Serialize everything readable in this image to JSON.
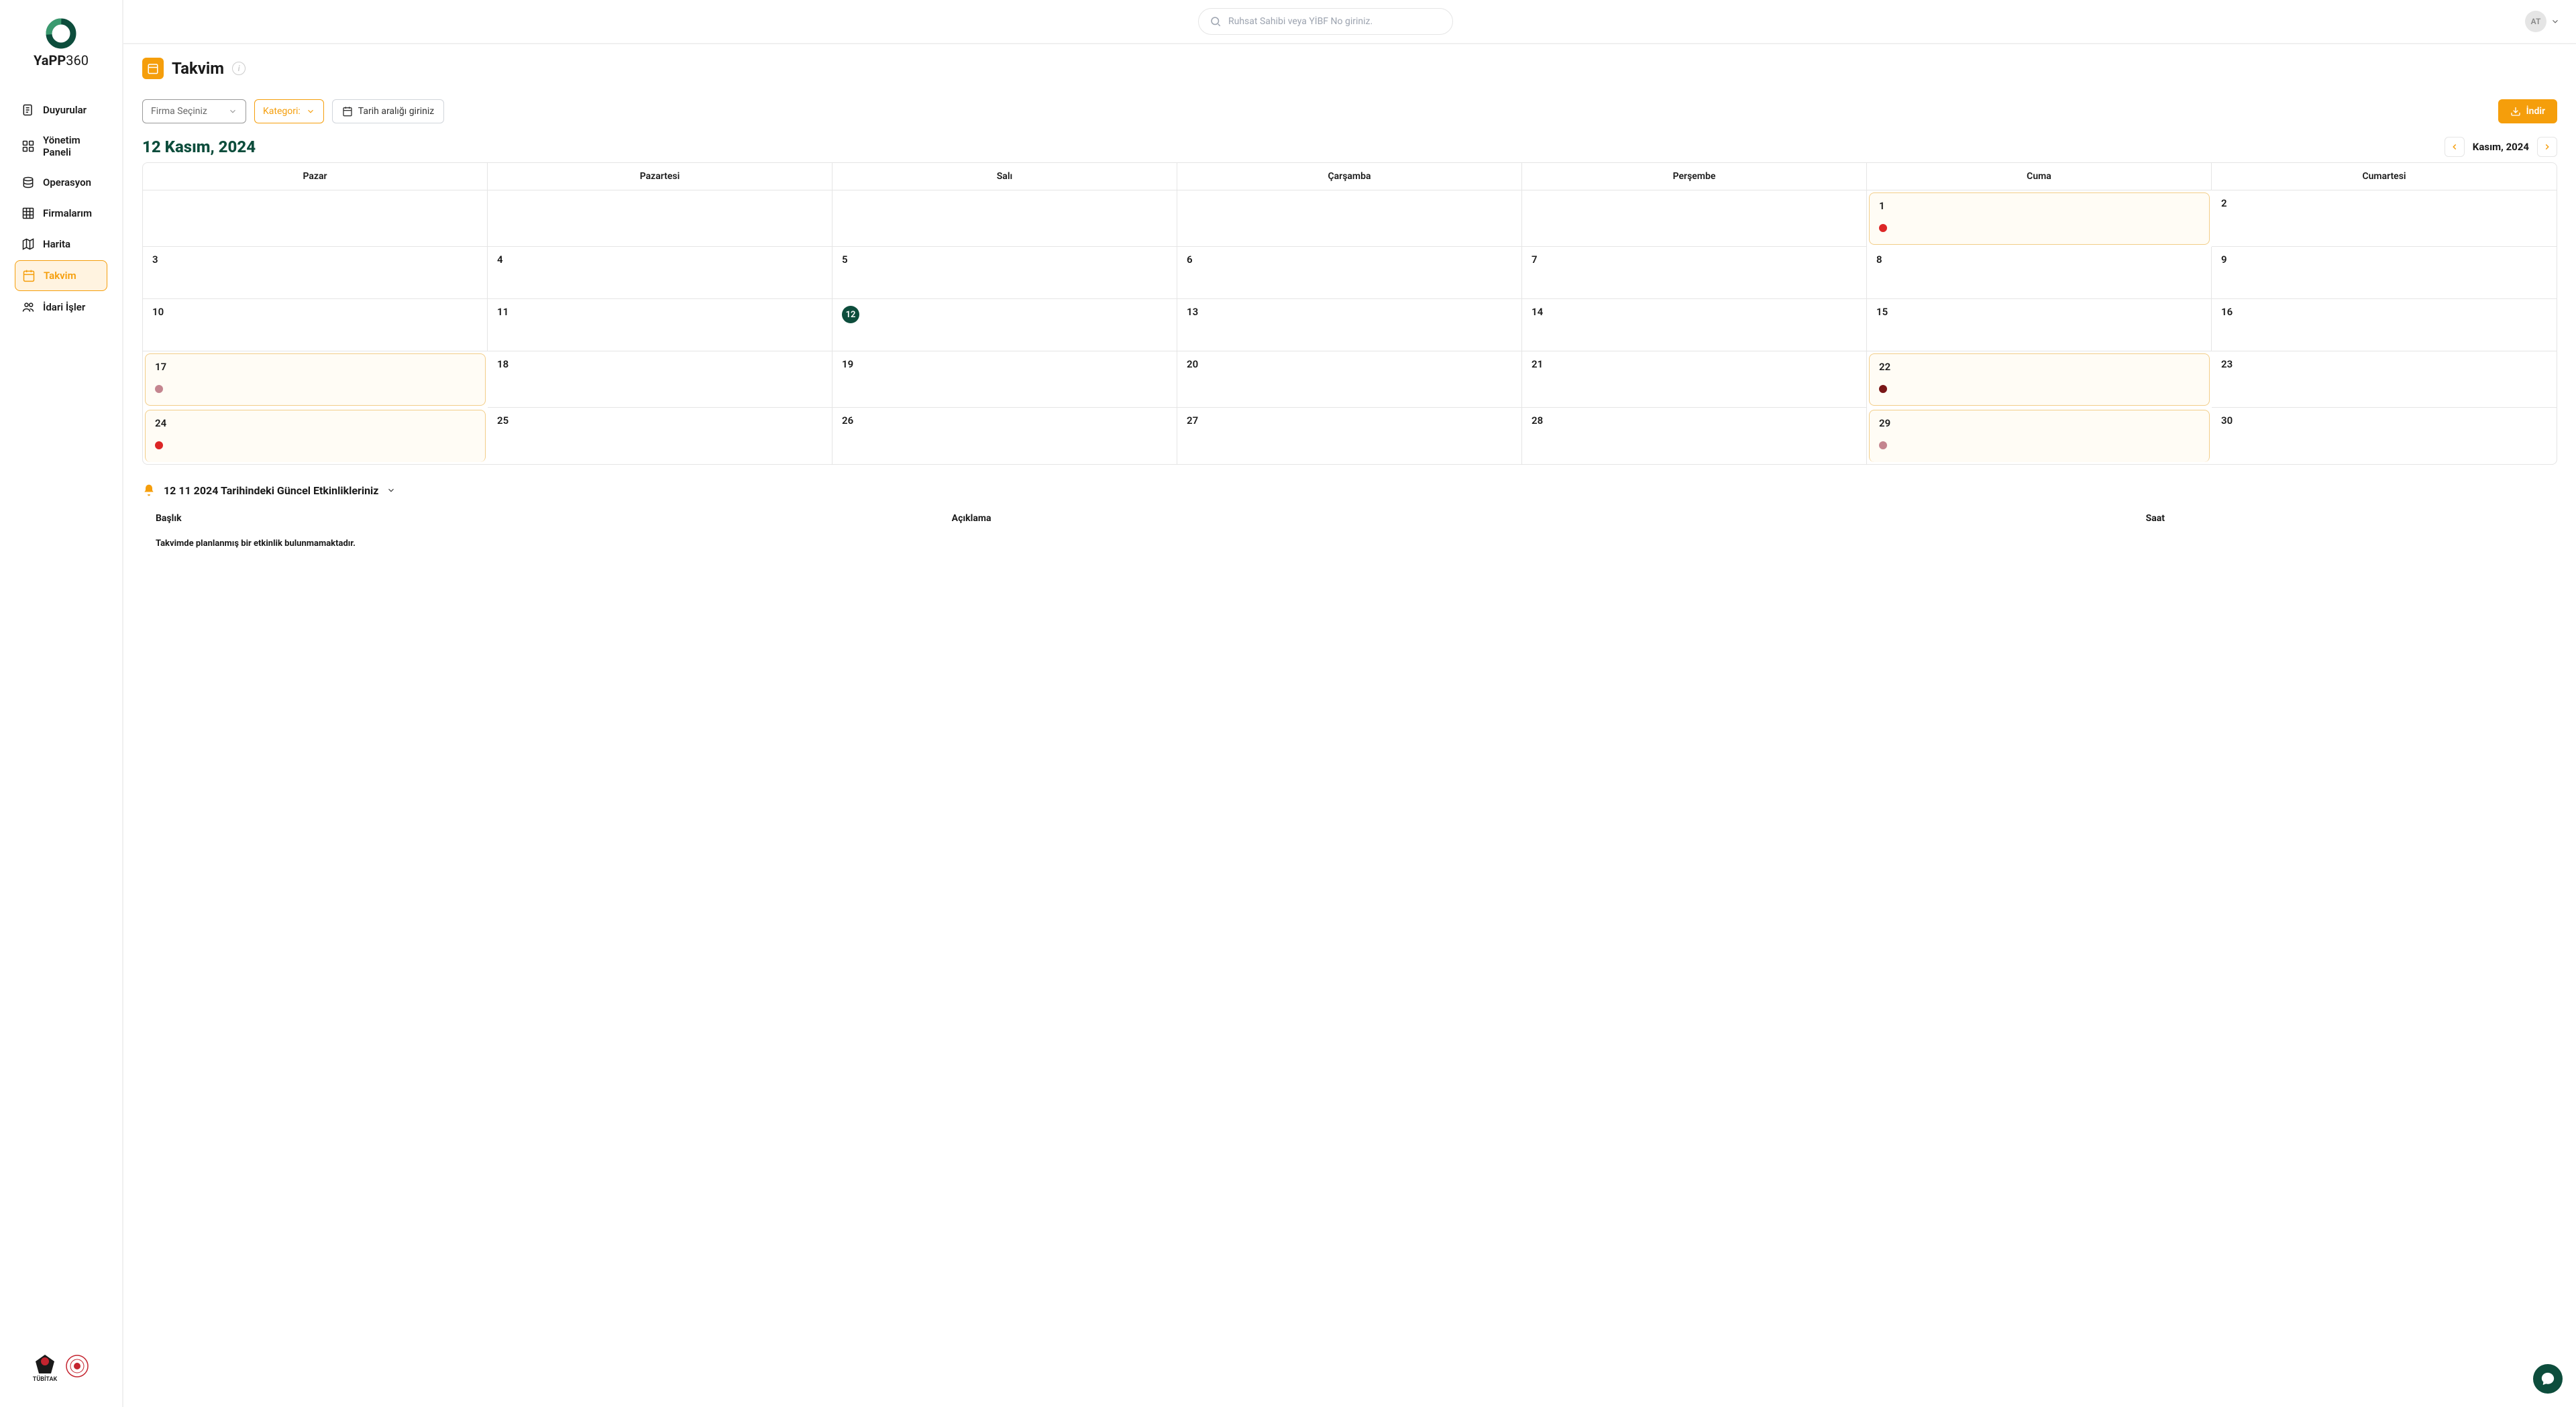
{
  "brand": {
    "name_bold": "YaPP",
    "name_thin": "360"
  },
  "search": {
    "placeholder": "Ruhsat Sahibi veya YİBF No giriniz."
  },
  "user": {
    "initials": "AT"
  },
  "nav": [
    {
      "label": "Duyurular"
    },
    {
      "label": "Yönetim Paneli"
    },
    {
      "label": "Operasyon"
    },
    {
      "label": "Firmalarım"
    },
    {
      "label": "Harita"
    },
    {
      "label": "Takvim"
    },
    {
      "label": "İdari İşler"
    }
  ],
  "page": {
    "title": "Takvim"
  },
  "filters": {
    "firma": "Firma Seçiniz",
    "kategori": "Kategori:",
    "date_range": "Tarih aralığı giriniz",
    "download": "İndir"
  },
  "calendar": {
    "current_date": "12 Kasım, 2024",
    "month_label": "Kasım, 2024",
    "weekdays": [
      "Pazar",
      "Pazartesi",
      "Salı",
      "Çarşamba",
      "Perşembe",
      "Cuma",
      "Cumartesi"
    ],
    "weeks": [
      [
        {
          "day": "",
          "today": false,
          "highlight": false,
          "dot": null
        },
        {
          "day": "",
          "today": false,
          "highlight": false,
          "dot": null
        },
        {
          "day": "",
          "today": false,
          "highlight": false,
          "dot": null
        },
        {
          "day": "",
          "today": false,
          "highlight": false,
          "dot": null
        },
        {
          "day": "",
          "today": false,
          "highlight": false,
          "dot": null
        },
        {
          "day": "1",
          "today": false,
          "highlight": true,
          "dot": "red"
        },
        {
          "day": "2",
          "today": false,
          "highlight": false,
          "dot": null
        }
      ],
      [
        {
          "day": "3",
          "today": false,
          "highlight": false,
          "dot": null
        },
        {
          "day": "4",
          "today": false,
          "highlight": false,
          "dot": null
        },
        {
          "day": "5",
          "today": false,
          "highlight": false,
          "dot": null
        },
        {
          "day": "6",
          "today": false,
          "highlight": false,
          "dot": null
        },
        {
          "day": "7",
          "today": false,
          "highlight": false,
          "dot": null
        },
        {
          "day": "8",
          "today": false,
          "highlight": false,
          "dot": null
        },
        {
          "day": "9",
          "today": false,
          "highlight": false,
          "dot": null
        }
      ],
      [
        {
          "day": "10",
          "today": false,
          "highlight": false,
          "dot": null
        },
        {
          "day": "11",
          "today": false,
          "highlight": false,
          "dot": null
        },
        {
          "day": "12",
          "today": true,
          "highlight": false,
          "dot": null
        },
        {
          "day": "13",
          "today": false,
          "highlight": false,
          "dot": null
        },
        {
          "day": "14",
          "today": false,
          "highlight": false,
          "dot": null
        },
        {
          "day": "15",
          "today": false,
          "highlight": false,
          "dot": null
        },
        {
          "day": "16",
          "today": false,
          "highlight": false,
          "dot": null
        }
      ],
      [
        {
          "day": "17",
          "today": false,
          "highlight": true,
          "dot": "pink"
        },
        {
          "day": "18",
          "today": false,
          "highlight": false,
          "dot": null
        },
        {
          "day": "19",
          "today": false,
          "highlight": false,
          "dot": null
        },
        {
          "day": "20",
          "today": false,
          "highlight": false,
          "dot": null
        },
        {
          "day": "21",
          "today": false,
          "highlight": false,
          "dot": null
        },
        {
          "day": "22",
          "today": false,
          "highlight": true,
          "dot": "darkred"
        },
        {
          "day": "23",
          "today": false,
          "highlight": false,
          "dot": null
        }
      ],
      [
        {
          "day": "24",
          "today": false,
          "highlight": true,
          "dot": "red"
        },
        {
          "day": "25",
          "today": false,
          "highlight": false,
          "dot": null
        },
        {
          "day": "26",
          "today": false,
          "highlight": false,
          "dot": null
        },
        {
          "day": "27",
          "today": false,
          "highlight": false,
          "dot": null
        },
        {
          "day": "28",
          "today": false,
          "highlight": false,
          "dot": null
        },
        {
          "day": "29",
          "today": false,
          "highlight": true,
          "dot": "pink"
        },
        {
          "day": "30",
          "today": false,
          "highlight": false,
          "dot": null
        }
      ]
    ]
  },
  "activities": {
    "title": "12 11 2024 Tarihindeki Güncel Etkinlikleriniz",
    "columns": [
      "Başlık",
      "Açıklama",
      "Saat"
    ],
    "empty": "Takvimde planlanmış bir etkinlik bulunmamaktadır."
  },
  "footer": {
    "tubitak": "TÜBİTAK"
  }
}
